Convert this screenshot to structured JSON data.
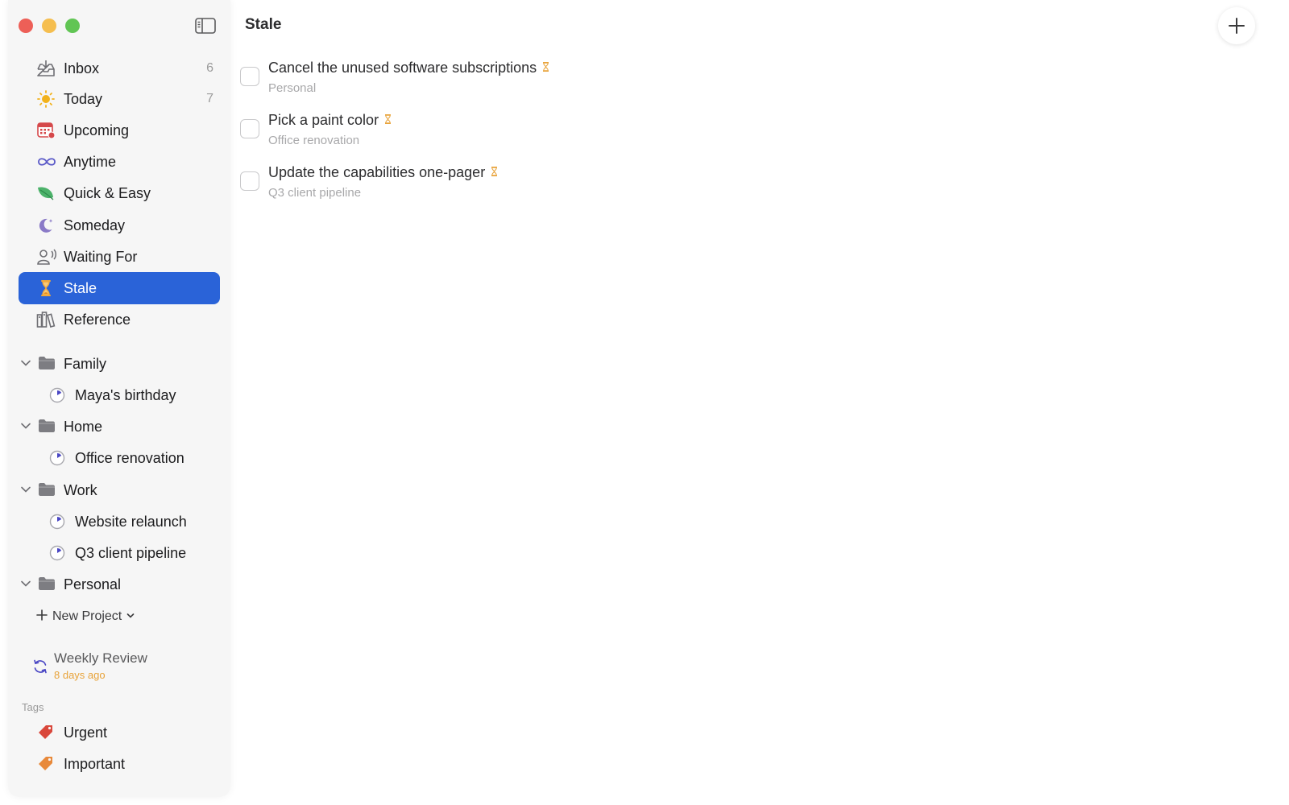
{
  "main": {
    "title": "Stale",
    "add_button_icon": "plus-icon",
    "tasks": [
      {
        "title": "Cancel the unused software subscriptions",
        "project": "Personal",
        "icon": "hourglass-icon"
      },
      {
        "title": "Pick a paint color",
        "project": "Office renovation",
        "icon": "hourglass-icon"
      },
      {
        "title": "Update the capabilities one-pager",
        "project": "Q3 client pipeline",
        "icon": "hourglass-icon"
      }
    ]
  },
  "sidebar": {
    "nav": [
      {
        "label": "Inbox",
        "count": "6",
        "icon": "inbox-icon"
      },
      {
        "label": "Today",
        "count": "7",
        "icon": "sun-icon"
      },
      {
        "label": "Upcoming",
        "count": "",
        "icon": "calendar-icon"
      },
      {
        "label": "Anytime",
        "count": "",
        "icon": "infinity-icon"
      },
      {
        "label": "Quick & Easy",
        "count": "",
        "icon": "leaf-icon"
      },
      {
        "label": "Someday",
        "count": "",
        "icon": "moon-icon"
      },
      {
        "label": "Waiting For",
        "count": "",
        "icon": "person-waiting-icon"
      },
      {
        "label": "Stale",
        "count": "",
        "icon": "hourglass-icon",
        "active": true
      },
      {
        "label": "Reference",
        "count": "",
        "icon": "books-icon"
      }
    ],
    "areas": [
      {
        "label": "Family",
        "projects": [
          "Maya's birthday"
        ]
      },
      {
        "label": "Home",
        "projects": [
          "Office renovation"
        ]
      },
      {
        "label": "Work",
        "projects": [
          "Website relaunch",
          "Q3 client pipeline"
        ]
      },
      {
        "label": "Personal",
        "projects": []
      }
    ],
    "new_project_label": "New Project",
    "weekly_review": {
      "title": "Weekly Review",
      "subtitle": "8 days ago"
    },
    "tags_heading": "Tags",
    "tags": [
      {
        "label": "Urgent",
        "color": "#d9473b"
      },
      {
        "label": "Important",
        "color": "#e8893a"
      }
    ]
  },
  "colors": {
    "accent": "#2a63d8",
    "hourglass": "#e8a33a",
    "review_subtitle": "#e8a33a"
  }
}
